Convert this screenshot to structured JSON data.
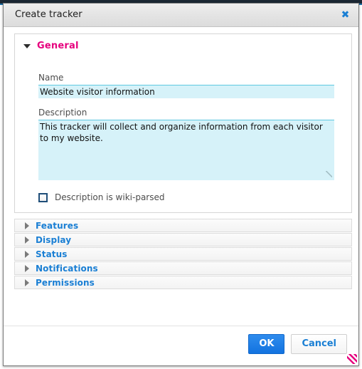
{
  "window": {
    "title": "Create tracker",
    "close_icon": "close-icon",
    "close_glyph": "✖",
    "resize_grip_icon": "resize-grip-icon"
  },
  "colors": {
    "legend_accent": "#e6007e",
    "section_link": "#1a7fd4",
    "field_background": "#d6f2f9",
    "field_border": "#5ec8e0",
    "primary_button": "#1273e0",
    "checkbox_border": "#1f4e79"
  },
  "general_panel": {
    "legend": "General",
    "expanded": true,
    "toggle_icon": "chevron-down-icon",
    "fields": {
      "name": {
        "label": "Name",
        "value": "Website visitor information",
        "placeholder": ""
      },
      "description": {
        "label": "Description",
        "value": "This tracker will collect and organize information from each visitor to my website.",
        "placeholder": "",
        "resize_handle_icon": "textarea-resize-icon"
      },
      "wiki_parsed": {
        "label": "Description is wiki-parsed",
        "checked": false
      }
    }
  },
  "sections": [
    {
      "label": "Features",
      "expanded": false,
      "toggle_icon": "chevron-right-icon"
    },
    {
      "label": "Display",
      "expanded": false,
      "toggle_icon": "chevron-right-icon"
    },
    {
      "label": "Status",
      "expanded": false,
      "toggle_icon": "chevron-right-icon"
    },
    {
      "label": "Notifications",
      "expanded": false,
      "toggle_icon": "chevron-right-icon"
    },
    {
      "label": "Permissions",
      "expanded": false,
      "toggle_icon": "chevron-right-icon"
    }
  ],
  "footer": {
    "ok_label": "OK",
    "cancel_label": "Cancel"
  }
}
